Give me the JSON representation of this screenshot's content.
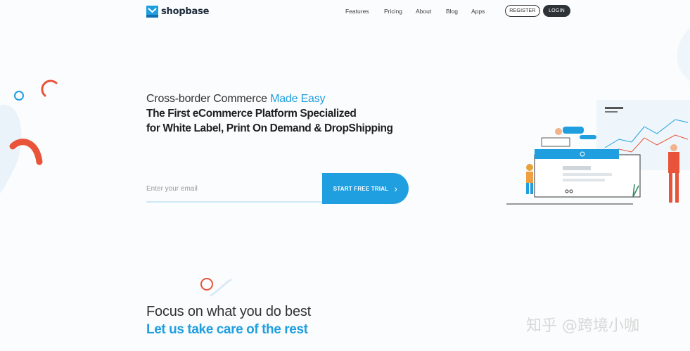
{
  "header": {
    "brand": "shopbase",
    "nav": [
      {
        "label": "Features"
      },
      {
        "label": "Pricing"
      },
      {
        "label": "About"
      },
      {
        "label": "Blog"
      },
      {
        "label": "Apps"
      }
    ],
    "register_label": "REGISTER",
    "login_label": "LOGIN"
  },
  "hero": {
    "line1_prefix": "Cross-border Commerce ",
    "line1_accent": "Made Easy",
    "line2": "The First eCommerce Platform Specialized",
    "line3": "for White Label, Print On Demand & DropShipping",
    "email_placeholder": "Enter your email",
    "cta_label": "START FREE TRIAL"
  },
  "section2": {
    "line1": "Focus on what you do best",
    "line2": "Let us take care of the rest"
  },
  "watermark": "知乎 @跨境小咖",
  "colors": {
    "accent": "#1f9fe0",
    "dark": "#2e3338",
    "decor_red": "#e8533a"
  },
  "icons": {
    "logo": "shopbase-bag-icon",
    "cta": "chevron-right-icon"
  }
}
